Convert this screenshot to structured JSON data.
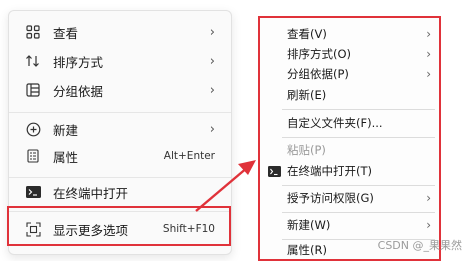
{
  "new_menu": {
    "items": [
      {
        "label": "查看",
        "icon": "grid-view-icon",
        "chevron": "›"
      },
      {
        "label": "排序方式",
        "icon": "sort-icon",
        "chevron": "›"
      },
      {
        "label": "分组依据",
        "icon": "group-by-icon",
        "chevron": "›"
      },
      {
        "label": "新建",
        "icon": "plus-circle-icon",
        "chevron": "›"
      },
      {
        "label": "属性",
        "icon": "properties-icon",
        "shortcut": "Alt+Enter"
      },
      {
        "label": "在终端中打开",
        "icon": "terminal-icon"
      },
      {
        "label": "显示更多选项",
        "icon": "more-options-icon",
        "shortcut": "Shift+F10"
      }
    ]
  },
  "classic_menu": {
    "items": [
      {
        "label": "查看(V)",
        "chevron": "›"
      },
      {
        "label": "排序方式(O)",
        "chevron": "›"
      },
      {
        "label": "分组依据(P)",
        "chevron": "›"
      },
      {
        "label": "刷新(E)"
      },
      {
        "label": "自定义文件夹(F)..."
      },
      {
        "label": "粘贴(P)",
        "disabled": true
      },
      {
        "label": "在终端中打开(T)",
        "icon": "terminal-icon"
      },
      {
        "label": "授予访问权限(G)",
        "chevron": "›"
      },
      {
        "label": "新建(W)",
        "chevron": "›"
      },
      {
        "label": "属性(R)"
      }
    ]
  },
  "colors": {
    "highlight": "#e0323a"
  },
  "watermark": "CSDN @_果果然"
}
